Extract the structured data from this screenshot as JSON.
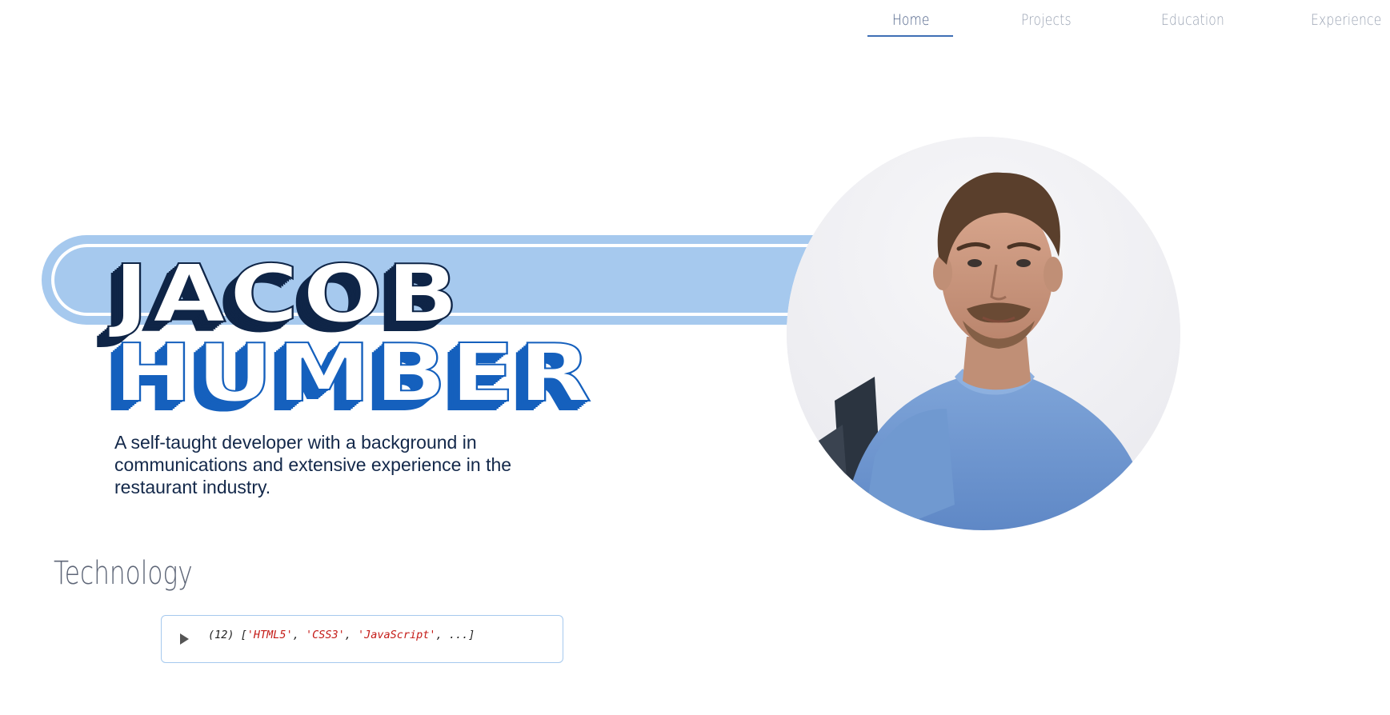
{
  "nav": {
    "items": [
      {
        "label": "Home",
        "active": true
      },
      {
        "label": "Projects",
        "active": false
      },
      {
        "label": "Education",
        "active": false
      },
      {
        "label": "Experience",
        "active": false
      }
    ]
  },
  "hero": {
    "first_name": "JACOB",
    "last_name": "HUMBER",
    "bio": "A self-taught developer with a background in communications and extensive experience in the restaurant industry."
  },
  "avatar": {
    "icon": "profile-photo"
  },
  "technology": {
    "title": "Technology",
    "console": {
      "count": "(12)",
      "open_bracket": "[",
      "items": [
        "'HTML5'",
        "'CSS3'",
        "'JavaScript'"
      ],
      "separator": ", ",
      "ellipsis": "...]"
    }
  },
  "colors": {
    "accent": "#1560bd",
    "dark_navy": "#0f2547",
    "band": "#a6c9ee"
  }
}
